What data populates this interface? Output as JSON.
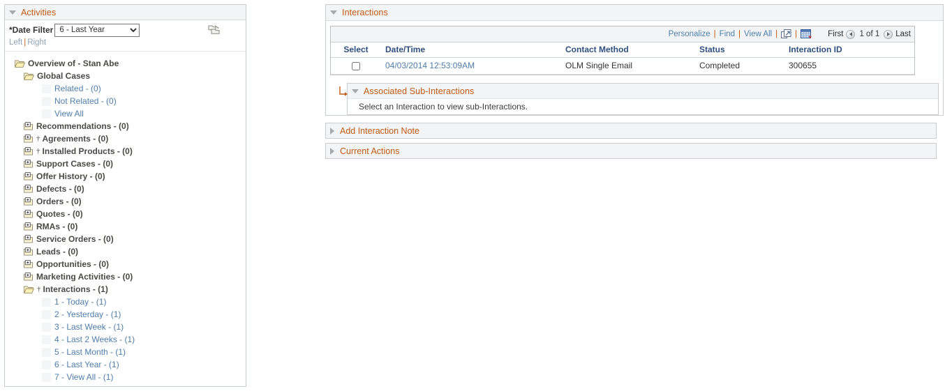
{
  "left": {
    "header": {
      "title": "Activities",
      "toggle_icon": "triangle-down-icon"
    },
    "filter": {
      "label": "*Date Filter",
      "selected": "6 - Last Year",
      "options": [
        "1 - Today",
        "2 - Yesterday",
        "3 - Last Week",
        "4 - Last 2 Weeks",
        "5 - Last Month",
        "6 - Last Year",
        "7 - View All"
      ]
    },
    "align": {
      "left": "Left",
      "separator": "|",
      "right": "Right"
    },
    "collapse_all_icon": "collapse-folders-icon",
    "tree": [
      {
        "label": "Overview of - Stan Abe",
        "type": "bold",
        "icon": "folder-open-icon",
        "indent": 0,
        "dagger": false
      },
      {
        "label": "Global Cases",
        "type": "bold",
        "icon": "folder-open-icon",
        "indent": 1,
        "dagger": false
      },
      {
        "label": "Related - (0)",
        "type": "link",
        "icon": "spacer",
        "indent": 3,
        "dagger": false
      },
      {
        "label": "Not Related - (0)",
        "type": "link",
        "icon": "spacer",
        "indent": 3,
        "dagger": false
      },
      {
        "label": "View All",
        "type": "link",
        "icon": "spacer",
        "indent": 3,
        "dagger": false
      },
      {
        "label": "Recommendations - (0)",
        "type": "bold",
        "icon": "folder-plus-icon",
        "indent": 1,
        "dagger": false
      },
      {
        "label": "Agreements - (0)",
        "type": "bold",
        "icon": "folder-plus-icon",
        "indent": 1,
        "dagger": true
      },
      {
        "label": "Installed Products - (0)",
        "type": "bold",
        "icon": "folder-plus-icon",
        "indent": 1,
        "dagger": true
      },
      {
        "label": "Support Cases - (0)",
        "type": "bold",
        "icon": "folder-plus-icon",
        "indent": 1,
        "dagger": false
      },
      {
        "label": "Offer History - (0)",
        "type": "bold",
        "icon": "folder-plus-icon",
        "indent": 1,
        "dagger": false
      },
      {
        "label": "Defects - (0)",
        "type": "bold",
        "icon": "folder-plus-icon",
        "indent": 1,
        "dagger": false
      },
      {
        "label": "Orders - (0)",
        "type": "bold",
        "icon": "folder-plus-icon",
        "indent": 1,
        "dagger": false
      },
      {
        "label": "Quotes - (0)",
        "type": "bold",
        "icon": "folder-plus-icon",
        "indent": 1,
        "dagger": false
      },
      {
        "label": "RMAs - (0)",
        "type": "bold",
        "icon": "folder-plus-icon",
        "indent": 1,
        "dagger": false
      },
      {
        "label": "Service Orders - (0)",
        "type": "bold",
        "icon": "folder-plus-icon",
        "indent": 1,
        "dagger": false
      },
      {
        "label": "Leads - (0)",
        "type": "bold",
        "icon": "folder-plus-icon",
        "indent": 1,
        "dagger": false
      },
      {
        "label": "Opportunities - (0)",
        "type": "bold",
        "icon": "folder-plus-icon",
        "indent": 1,
        "dagger": false
      },
      {
        "label": "Marketing Activities - (0)",
        "type": "bold",
        "icon": "folder-plus-icon",
        "indent": 1,
        "dagger": false
      },
      {
        "label": "Interactions - (1)",
        "type": "bold",
        "icon": "folder-open-icon",
        "indent": 1,
        "dagger": true
      },
      {
        "label": "1 - Today - (1)",
        "type": "link",
        "icon": "spacer",
        "indent": 3,
        "dagger": false
      },
      {
        "label": "2 - Yesterday - (1)",
        "type": "link",
        "icon": "spacer",
        "indent": 3,
        "dagger": false
      },
      {
        "label": "3 - Last Week - (1)",
        "type": "link",
        "icon": "spacer",
        "indent": 3,
        "dagger": false
      },
      {
        "label": "4 - Last 2 Weeks - (1)",
        "type": "link",
        "icon": "spacer",
        "indent": 3,
        "dagger": false
      },
      {
        "label": "5 - Last Month - (1)",
        "type": "link",
        "icon": "spacer",
        "indent": 3,
        "dagger": false
      },
      {
        "label": "6 - Last Year - (1)",
        "type": "link",
        "icon": "spacer",
        "indent": 3,
        "dagger": false
      },
      {
        "label": "7 - View All - (1)",
        "type": "link",
        "icon": "spacer",
        "indent": 3,
        "dagger": false
      }
    ]
  },
  "interactions": {
    "header": {
      "title": "Interactions",
      "toggle_icon": "triangle-down-icon"
    },
    "toolbar": {
      "personalize": "Personalize",
      "find": "Find",
      "view_all": "View All",
      "sep": "|",
      "zoom_icon": "expand-window-icon",
      "download_icon": "download-spreadsheet-icon",
      "first": "First",
      "page_label": "1 of 1",
      "last": "Last",
      "prev_icon": "prev-arrow-icon",
      "next_icon": "next-arrow-icon"
    },
    "grid": {
      "columns": [
        "Select",
        "Date/Time",
        "Contact Method",
        "Status",
        "Interaction ID"
      ],
      "rows": [
        {
          "selected": false,
          "datetime": "04/03/2014 12:53:09AM",
          "contact_method": "OLM Single Email",
          "status": "Completed",
          "interaction_id": "300655"
        }
      ]
    },
    "sub": {
      "header": {
        "title": "Associated Sub-Interactions",
        "toggle_icon": "triangle-down-icon"
      },
      "message": "Select an Interaction to view sub-Interactions.",
      "elbow_icon": "elbow-arrow-icon"
    }
  },
  "sections": [
    {
      "title": "Add Interaction Note",
      "toggle_icon": "triangle-right-icon"
    },
    {
      "title": "Current Actions",
      "toggle_icon": "triangle-right-icon"
    }
  ],
  "colors": {
    "accent_orange": "#c05a11",
    "link_blue": "#4f7dab",
    "header_blue": "#2f4f7f",
    "panel_bg": "#f2f4f5"
  }
}
